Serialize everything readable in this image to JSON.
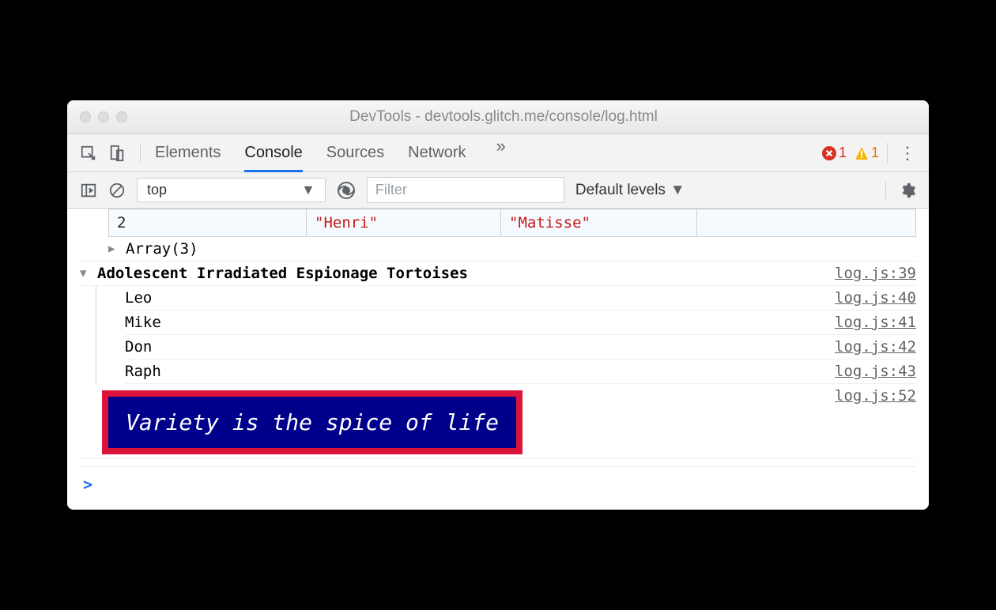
{
  "window": {
    "title": "DevTools - devtools.glitch.me/console/log.html"
  },
  "tabs": {
    "elements": "Elements",
    "console": "Console",
    "sources": "Sources",
    "network": "Network"
  },
  "badges": {
    "error_count": "1",
    "warn_count": "1"
  },
  "toolbar": {
    "context": "top",
    "filter_placeholder": "Filter",
    "levels": "Default levels"
  },
  "table_row": {
    "index": "2",
    "first": "\"Henri\"",
    "last": "\"Matisse\""
  },
  "array_line": "Array(3)",
  "group": {
    "header": "Adolescent Irradiated Espionage Tortoises",
    "header_src": "log.js:39",
    "items": [
      {
        "text": "Leo",
        "src": "log.js:40"
      },
      {
        "text": "Mike",
        "src": "log.js:41"
      },
      {
        "text": "Don",
        "src": "log.js:42"
      },
      {
        "text": "Raph",
        "src": "log.js:43"
      }
    ]
  },
  "styled_log": {
    "text": "Variety is the spice of life",
    "src": "log.js:52"
  },
  "prompt": ">"
}
